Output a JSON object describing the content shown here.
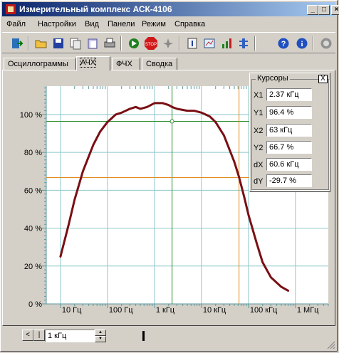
{
  "window": {
    "title": "Измерительный комплекс АСК-4106"
  },
  "menu": [
    "Файл",
    "Настройки",
    "Вид",
    "Панели",
    "Режим",
    "Справка"
  ],
  "toolbar": {
    "icons": [
      "exit-icon",
      "open-folder-icon",
      "save-icon",
      "copy-icon",
      "paste-icon",
      "print-icon",
      "run-icon",
      "stop-icon",
      "single-run-icon",
      "info-panel-icon",
      "settings-icon",
      "signal-icon",
      "filter-icon",
      "help-icon",
      "about-icon",
      "record-icon"
    ]
  },
  "tabs": [
    {
      "label": "Осциллограммы",
      "active": false
    },
    {
      "label": "АЧХ",
      "active": true
    },
    {
      "label": "ФЧХ",
      "active": false
    },
    {
      "label": "Сводка",
      "active": false
    }
  ],
  "cursors": {
    "title": "Курсоры",
    "close": "X",
    "rows": [
      {
        "label": "X1",
        "value": "2.37 кГц"
      },
      {
        "label": "Y1",
        "value": "96.4 %"
      },
      {
        "label": "X2",
        "value": "63 кГц"
      },
      {
        "label": "Y2",
        "value": "66.7 %"
      },
      {
        "label": "dX",
        "value": "60.6 кГц"
      },
      {
        "label": "dY",
        "value": "-29.7 %"
      }
    ]
  },
  "chart_data": {
    "type": "line",
    "x_scale": "log",
    "xlim": [
      5,
      5000000
    ],
    "ylim": [
      0,
      115
    ],
    "x_ticks": [
      {
        "value": 10,
        "label": "10 Гц"
      },
      {
        "value": 100,
        "label": "100 Гц"
      },
      {
        "value": 1000,
        "label": "1 кГц"
      },
      {
        "value": 10000,
        "label": "10 кГц"
      },
      {
        "value": 100000,
        "label": "100 кГц"
      },
      {
        "value": 1000000,
        "label": "1 МГц"
      }
    ],
    "y_ticks": [
      {
        "value": 0,
        "label": "0 %"
      },
      {
        "value": 20,
        "label": "20 %"
      },
      {
        "value": 40,
        "label": "40 %"
      },
      {
        "value": 60,
        "label": "60 %"
      },
      {
        "value": 80,
        "label": "80 %"
      },
      {
        "value": 100,
        "label": "100 %"
      }
    ],
    "grid": true,
    "series": [
      {
        "color": "#7a0f14",
        "x": [
          10,
          15,
          20,
          30,
          50,
          70,
          100,
          150,
          200,
          300,
          400,
          500,
          700,
          1000,
          1500,
          2000,
          2370,
          3000,
          5000,
          7000,
          10000,
          15000,
          20000,
          30000,
          50000,
          63000,
          80000,
          100000,
          150000,
          200000,
          300000,
          500000,
          700000
        ],
        "y": [
          25,
          42,
          55,
          70,
          84,
          91,
          96,
          100,
          101,
          103,
          104,
          103,
          104,
          106,
          106,
          105,
          104,
          103,
          102,
          102,
          101,
          99,
          96,
          89,
          75,
          67,
          57,
          47,
          32,
          22,
          14,
          9,
          7
        ]
      }
    ],
    "cursor1": {
      "x": 2370,
      "y": 96.4,
      "color": "#2a8c2a"
    },
    "cursor2": {
      "x": 63000,
      "y": 66.7,
      "color": "#e08a1e"
    }
  },
  "bottom": {
    "zoom_value": "1 кГц",
    "scroll_left": "<",
    "scroll_right": "|"
  }
}
